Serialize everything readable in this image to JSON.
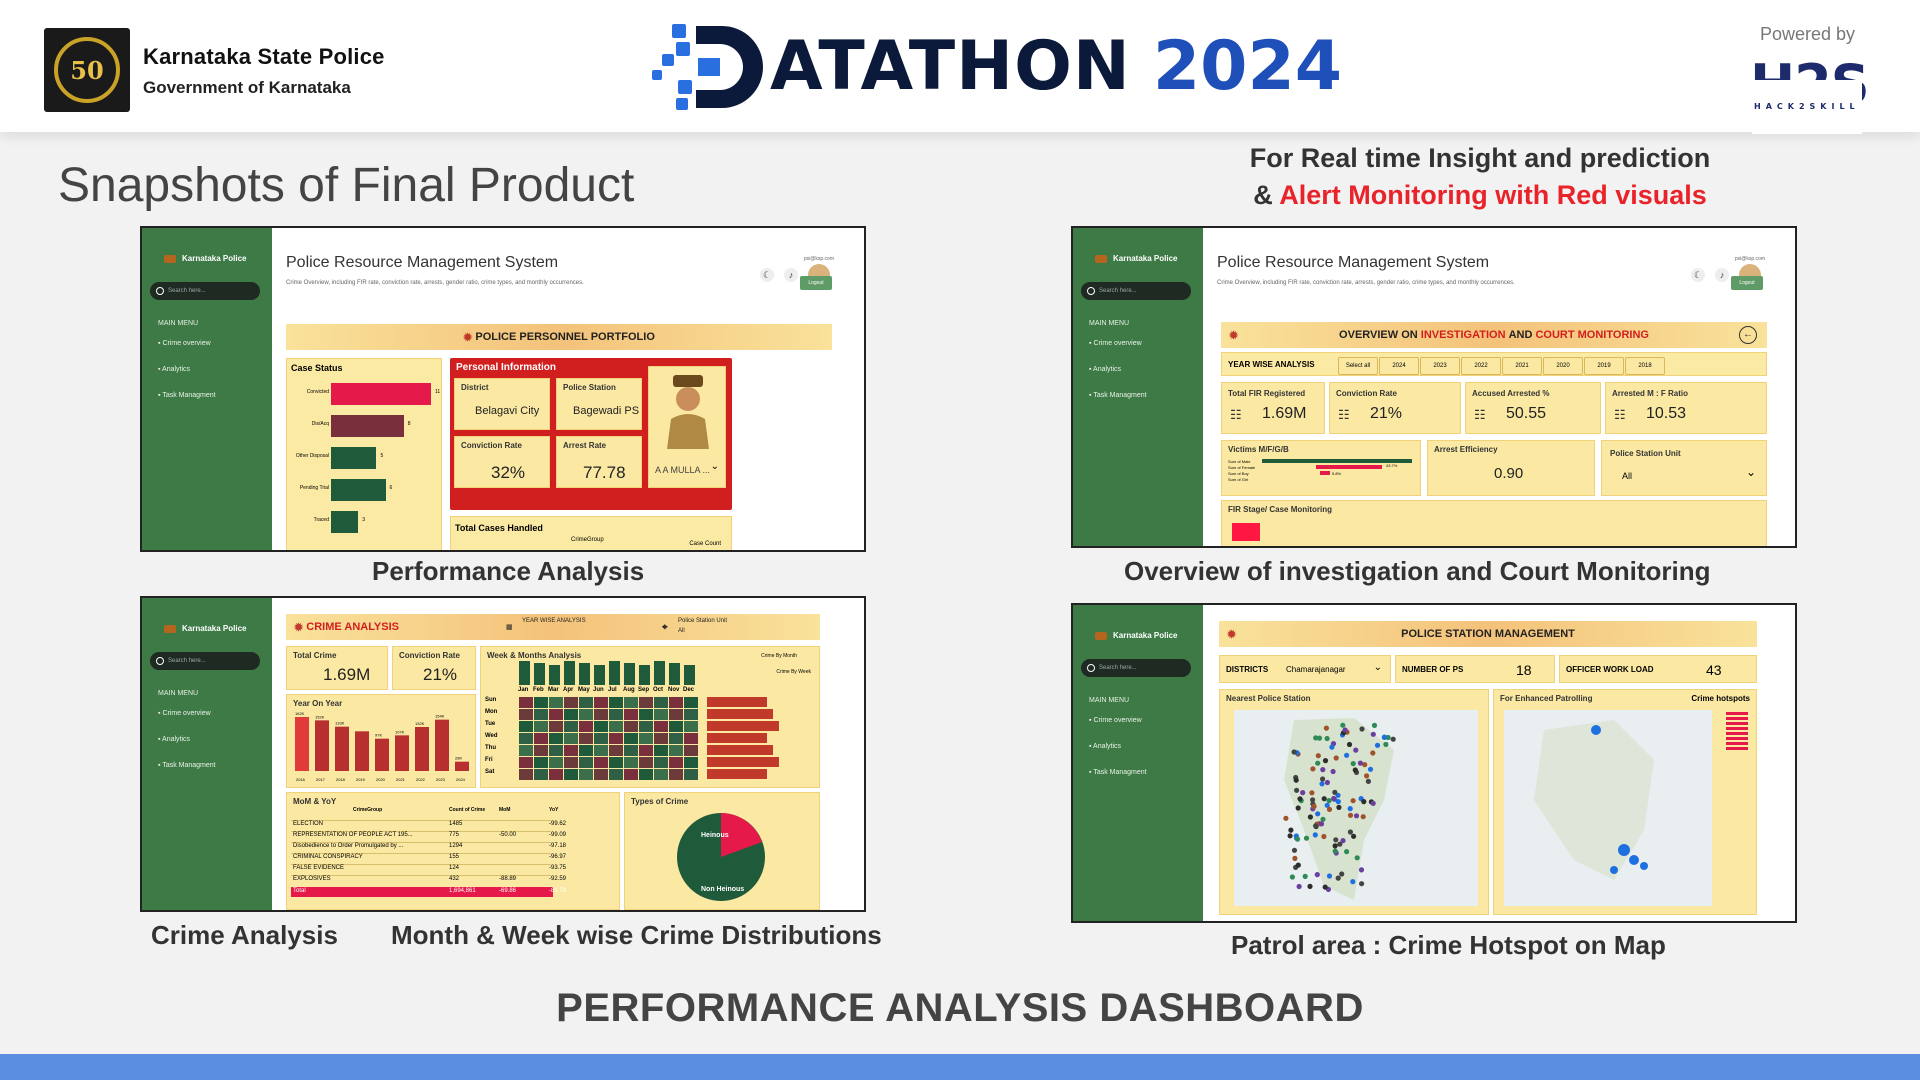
{
  "header": {
    "org_name": "Karnataka State Police",
    "org_sub": "Government of Karnataka",
    "logo_text": "50",
    "brand_word": "ATATHON",
    "brand_year": "2024",
    "powered_by": "Powered by",
    "sponsor": "H2S",
    "sponsor_small": "HACK2SKILL"
  },
  "titles": {
    "left": "Snapshots of Final Product",
    "right_line1": "For Real time Insight and prediction",
    "right_line2_prefix": "& ",
    "right_line2_red": "Alert Monitoring with Red visuals",
    "bottom": "PERFORMANCE ANALYSIS DASHBOARD"
  },
  "captions": {
    "c1": "Performance Analysis",
    "c2": "Overview of investigation and Court Monitoring",
    "c3a": "Crime Analysis",
    "c3b": "Month & Week wise Crime Distributions",
    "c4": "Patrol area : Crime Hotspot on Map"
  },
  "sidebar": {
    "brand": "Karnataka Police",
    "search_placeholder": "Search here...",
    "main_menu": "MAIN MENU",
    "items": [
      "Crime overview",
      "Analytics",
      "Task Managment"
    ]
  },
  "app": {
    "title": "Police Resource Management System",
    "subtitle": "Crime Overview, including FIR rate, conviction rate, arrests, gender ratio, crime types, and monthly occurrences.",
    "email": "psi@ksp.com",
    "logout": "Logout"
  },
  "shot1": {
    "banner": "POLICE PERSONNEL PORTFOLIO",
    "case_status": "Case Status",
    "case_bars": [
      {
        "label": "Convicted",
        "value": 11,
        "color": "#e6194b"
      },
      {
        "label": "Dis/Acq",
        "value": 8,
        "color": "#7a2f3c"
      },
      {
        "label": "Other Disposal",
        "value": 5,
        "color": "#1f5a3a"
      },
      {
        "label": "Pending Trial",
        "value": 6,
        "color": "#1f5a3a"
      },
      {
        "label": "Traced",
        "value": 3,
        "color": "#1f5a3a"
      }
    ],
    "personal_info": "Personal Information",
    "district_label": "District",
    "district": "Belagavi City",
    "station_label": "Police Station",
    "station": "Bagewadi PS",
    "conviction_label": "Conviction Rate",
    "conviction": "32%",
    "arrest_label": "Arrest Rate",
    "arrest": "77.78",
    "officer": "A A MULLA ...",
    "total_cases": "Total Cases Handled",
    "crime_group": "CrimeGroup",
    "case_count": "Case Count"
  },
  "shot2": {
    "banner_a": "OVERVIEW ON ",
    "banner_b": "INVESTIGATION",
    "banner_c": " AND ",
    "banner_d": "COURT MONITORING",
    "year_wise": "YEAR WISE ANALYSIS",
    "years": [
      "Select all",
      "2024",
      "2023",
      "2022",
      "2021",
      "2020",
      "2019",
      "2018"
    ],
    "kpis": [
      {
        "label": "Total FIR Registered",
        "value": "1.69M"
      },
      {
        "label": "Conviction Rate",
        "value": "21%"
      },
      {
        "label": "Accused Arrested  %",
        "value": "50.55"
      },
      {
        "label": "Arrested M : F Ratio",
        "value": "10.53"
      }
    ],
    "victims": "Victims M/F/G/B",
    "victim_rows": [
      "Sum of Male",
      "Sum of Female",
      "Sum of Boy",
      "Sum of Girl"
    ],
    "victim_pct1": "43.7%",
    "victim_pct2": "5.8%",
    "arrest_eff": "Arrest Efficiency",
    "arrest_eff_value": "0.90",
    "ps_unit": "Police Station Unit",
    "ps_unit_value": "All",
    "fir_stage": "FIR Stage/ Case Monitoring"
  },
  "shot3": {
    "banner": "CRIME ANALYSIS",
    "year_wise": "YEAR WISE ANALYSIS",
    "ps_unit": "Police Station Unit",
    "ps_unit_value": "All",
    "total_crime": "Total Crime",
    "total_crime_value": "1.69M",
    "conviction_rate": "Conviction Rate",
    "conviction_value": "21%",
    "week_months": "Week & Months Analysis",
    "crime_by_month": "Crime By Month",
    "crime_by_week": "Crime By Week",
    "months": [
      "Jan",
      "Feb",
      "Mar",
      "Apr",
      "May",
      "Jun",
      "Jul",
      "Aug",
      "Sep",
      "Oct",
      "Nov",
      "Dec"
    ],
    "days": [
      "Sun",
      "Mon",
      "Tue",
      "Wed",
      "Thu",
      "Fri",
      "Sat"
    ],
    "year_on_year": "Year On Year",
    "yoy_years": [
      "2016",
      "2017",
      "2018",
      "2019",
      "2020",
      "2021",
      "2022",
      "2023",
      "2024"
    ],
    "yoy_values": [
      162,
      152,
      133,
      119,
      97,
      107,
      132,
      154,
      28
    ],
    "yoy_labels": [
      "162K",
      "152K",
      "133K",
      "",
      "97K",
      "107K",
      "132K",
      "154K",
      "28K"
    ],
    "mom_yoy": "MoM & YoY",
    "table_headers": [
      "CrimeGroup",
      "Count of Crime",
      "MoM",
      "YoY"
    ],
    "table_rows": [
      [
        "ELECTION",
        "1485",
        "",
        "-99.62"
      ],
      [
        "REPRESENTATION OF PEOPLE ACT 195...",
        "775",
        "-50.00",
        "-99.09"
      ],
      [
        "Disobedience to Order Promulgated by ...",
        "1294",
        "",
        "-97.18"
      ],
      [
        "CRIMINAL CONSPIRACY",
        "155",
        "",
        "-96.97"
      ],
      [
        "FALSE EVIDENCE",
        "124",
        "",
        "-93.75"
      ],
      [
        "EXPLOSIVES",
        "432",
        "-88.89",
        "-92.59"
      ]
    ],
    "total_row": [
      "Total",
      "1,694,861",
      "-69.86",
      "-81.73"
    ],
    "types_of_crime": "Types of Crime",
    "heinous": "Heinous",
    "non_heinous": "Non Heinous"
  },
  "shot4": {
    "banner": "POLICE STATION MANAGEMENT",
    "districts_label": "DISTRICTS",
    "districts_value": "Chamarajanagar",
    "num_ps_label": "NUMBER OF PS",
    "num_ps_value": "18",
    "workload_label": "OFFICER WORK LOAD",
    "workload_value": "43",
    "nearest": "Nearest Police Station",
    "patrolling": "For Enhanced Patrolling",
    "hotspots": "Crime hotspots"
  },
  "colors": {
    "sidebar": "#3d7a45",
    "panel": "#fbe9a3",
    "alert_red": "#e8232a",
    "accent_blue": "#1f4fb8",
    "bottom_bar": "#5b8de0"
  }
}
